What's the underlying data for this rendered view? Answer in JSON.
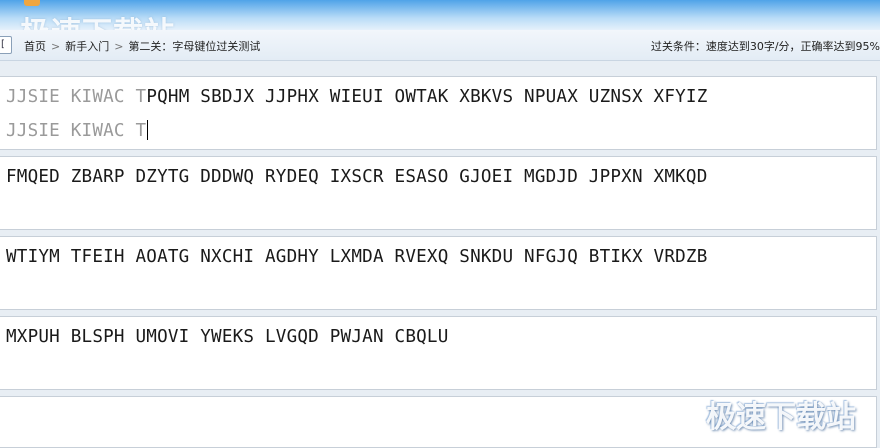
{
  "watermark": "极速下载站",
  "breadcrumb": {
    "back_glyph": "[",
    "items": [
      "首页",
      "新手入门",
      "第二关：字母键位过关测试"
    ],
    "separator": ">"
  },
  "pass_condition": "过关条件：速度达到30字/分，正确率达到95%",
  "lines": {
    "line1": {
      "typed": "JJSIE KIWAC T",
      "remaining": "PQHM SBDJX JJPHX WIEUI OWTAK XBKVS NPUAX UZNSX XFYIZ",
      "input": "JJSIE KIWAC T"
    },
    "line2": "FMQED ZBARP DZYTG DDDWQ RYDEQ IXSCR ESASO GJOEI MGDJD JPPXN XMKQD",
    "line3": "WTIYM TFEIH AOATG NXCHI AGDHY LXMDA RVEXQ SNKDU NFGJQ BTIKX VRDZB",
    "line4": "MXPUH BLSPH UMOVI YWEKS LVGQD PWJAN CBQLU"
  },
  "colors": {
    "typed_text": "#9a9a9a",
    "target_text": "#1a1a1a",
    "header_blue": "#4fa3e8"
  }
}
